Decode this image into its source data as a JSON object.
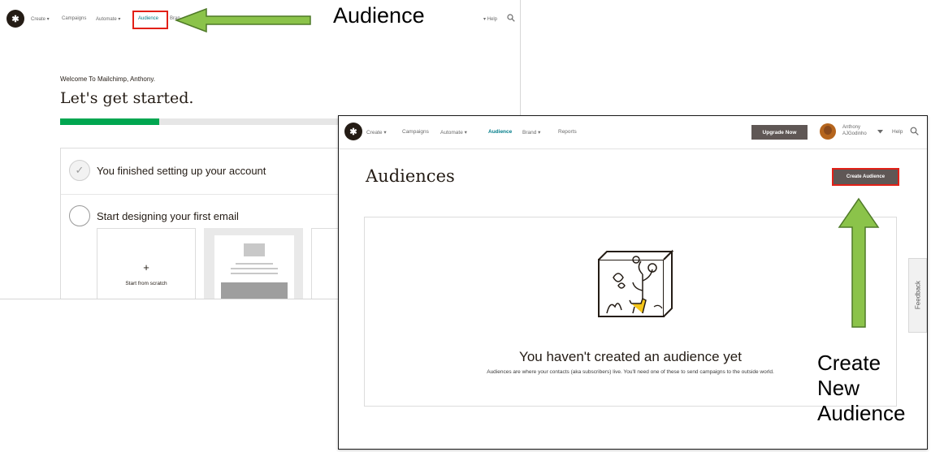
{
  "back_screen": {
    "nav": {
      "create": "Create ▾",
      "campaigns": "Campaigns",
      "automate": "Automate ▾",
      "audience": "Audience",
      "brand": "Bran",
      "help": "▾ Help"
    },
    "welcome": "Welcome To Mailchimp, Anthony.",
    "title": "Let's get started.",
    "progress_fraction": 0.34,
    "steps": [
      {
        "label": "You finished setting up your account",
        "done": true
      },
      {
        "label": "Start designing your first email",
        "done": false
      }
    ],
    "scratch_tile": {
      "plus": "+",
      "label": "Start from scratch"
    }
  },
  "front_screen": {
    "nav": {
      "create": "Create ▾",
      "campaigns": "Campaigns",
      "automate": "Automate ▾",
      "audience": "Audience",
      "brand": "Brand ▾",
      "reports": "Reports"
    },
    "upgrade_label": "Upgrade Now",
    "account_name": "Anthony",
    "account_user": "AJGodinho",
    "help": "Help",
    "heading": "Audiences",
    "create_button": "Create Audience",
    "empty_title": "You haven't created an audience yet",
    "empty_desc": "Audiences are where your contacts (aka subscribers) live. You'll need one of these to send campaigns to the outside world.",
    "feedback": "Feedback"
  },
  "callouts": {
    "audience": "Audience",
    "create_line1": "Create",
    "create_line2": "New",
    "create_line3": "Audience"
  },
  "colors": {
    "arrow_green": "#8bc34a",
    "arrow_border": "#4f7a28",
    "highlight_red": "#e22017",
    "progress_green": "#00a650",
    "active_nav": "#007c89"
  }
}
